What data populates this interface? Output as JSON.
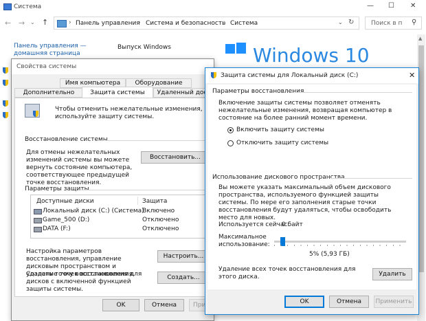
{
  "window": {
    "title": "Система",
    "controls": [
      "—",
      "☐",
      "✕"
    ]
  },
  "address": {
    "path": [
      "Панель управления",
      "Система и безопасность",
      "Система"
    ],
    "search_placeholder": "Поиск в п"
  },
  "left_panel": {
    "home_link": "Панель управления — домашняя страница"
  },
  "main": {
    "windows_edition_label": "Выпуск Windows",
    "logo_text": "Windows 10"
  },
  "sysprops": {
    "title": "Свойства системы",
    "tabs_row1": [
      "Имя компьютера",
      "Оборудование"
    ],
    "tabs_row2": [
      "Дополнительно",
      "Защита системы",
      "Удаленный дос"
    ],
    "intro": "Чтобы отменить нежелательные изменения, используйте защиту системы.",
    "restore_section": "Восстановление системы",
    "restore_desc": "Для отмены нежелательных изменений системы вы можете вернуть состояние компьютера, соответствующее предыдущей точке восстановления.",
    "restore_button": "Восстановить...",
    "protect_section": "Параметры защиты",
    "col_disks": "Доступные диски",
    "col_protect": "Защита",
    "disks": [
      {
        "name": "Локальный диск (C:) (Система)",
        "status": "Включено"
      },
      {
        "name": "Game_500 (D:)",
        "status": "Отключено"
      },
      {
        "name": "DATA (F:)",
        "status": "Отключено"
      }
    ],
    "configure_desc": "Настройка параметров восстановления, управление дисковым пространством и удаление точек восстановления.",
    "configure_button": "Настроить...",
    "create_desc": "Создать точку восстановления для дисков с включенной функцией защиты системы.",
    "create_button": "Создать...",
    "ok": "OK",
    "cancel": "Отмена",
    "apply": "Приме"
  },
  "protect_dialog": {
    "title": "Защита системы для Локальный диск (C:)",
    "restore_settings": "Параметры восстановления",
    "restore_desc": "Включение защиты системы позволяет отменять нежелательные изменения, возвращая компьютер в состояние на более ранний момент времени.",
    "radio_on": "Включить защиту системы",
    "radio_off": "Отключить защиту системы",
    "disk_usage": "Использование дискового пространства",
    "usage_desc": "Вы можете указать максимальный объем дискового пространства, используемого функцией защиты системы. По мере его заполнения старые точки восстановления будут удаляться, чтобы освободить место для новых.",
    "current_label": "Используется сейчас:",
    "current_value": "0 байт",
    "max_label": "Максимальное использование:",
    "slider_percent": 5,
    "slider_value": "5% (5,93 ГБ)",
    "delete_desc": "Удаление всех точек восстановления для этого диска.",
    "delete_button": "Удалить",
    "ok": "OK",
    "cancel": "Отмена",
    "apply": "Применить"
  },
  "colors": {
    "accent": "#0078d7",
    "shield_blue": "#2b6cc4",
    "shield_yellow": "#f2c100"
  }
}
